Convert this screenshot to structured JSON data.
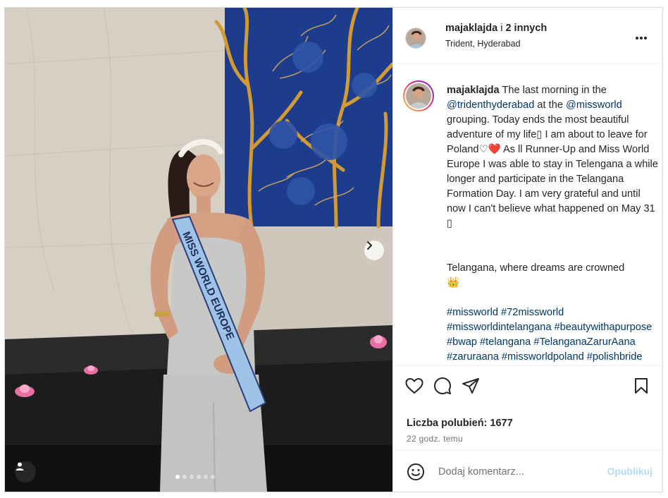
{
  "post": {
    "header": {
      "username": "majaklajda",
      "connector": "i",
      "others": "2 innych",
      "location": "Trident, Hyderabad",
      "more_icon": "more-horizontal-icon"
    },
    "caption": {
      "username": "majaklajda",
      "lines_1": "The last morning in the",
      "mention_1": "@tridenthyderabad",
      "text_2": "at the",
      "mention_2": "@missworld",
      "text_3": "grouping. Today ends the most beautiful adventure of my life▯ I am about to leave for Poland♡",
      "heart_emoji": "❤️",
      "text_4": "As ll Runner-Up and Miss World Europe I was able to stay in Telengana a while longer and participate in the Telangana Formation Day. I am very grateful and until now I can't believe what happened on May 31 ▯",
      "paragraph_2": "Telangana, where dreams are crowned",
      "crown_emoji": "👑",
      "hashtags": "#missworld #72missworld #missworldintelangana #beautywithapurpose #bwap #telangana #TelanganaZarurAana #zaruraana #missworldpoland #polishbride"
    },
    "likes_label": "Liczba polubień: 1677",
    "timestamp": "22 godz. temu",
    "comment": {
      "placeholder": "Dodaj komentarz...",
      "post_label": "Opublikuj"
    },
    "carousel": {
      "total_slides": 6,
      "active_slide": 1
    },
    "sash_text": "MISS WORLD EUROPE"
  },
  "colors": {
    "link": "#00376b",
    "muted": "#737373",
    "post_disabled": "#b3dbff",
    "border": "#dbdbdb"
  },
  "icons": [
    "heart-icon",
    "comment-icon",
    "share-icon",
    "bookmark-icon",
    "emoji-icon",
    "user-tag-icon",
    "chevron-right-icon",
    "more-horizontal-icon"
  ]
}
